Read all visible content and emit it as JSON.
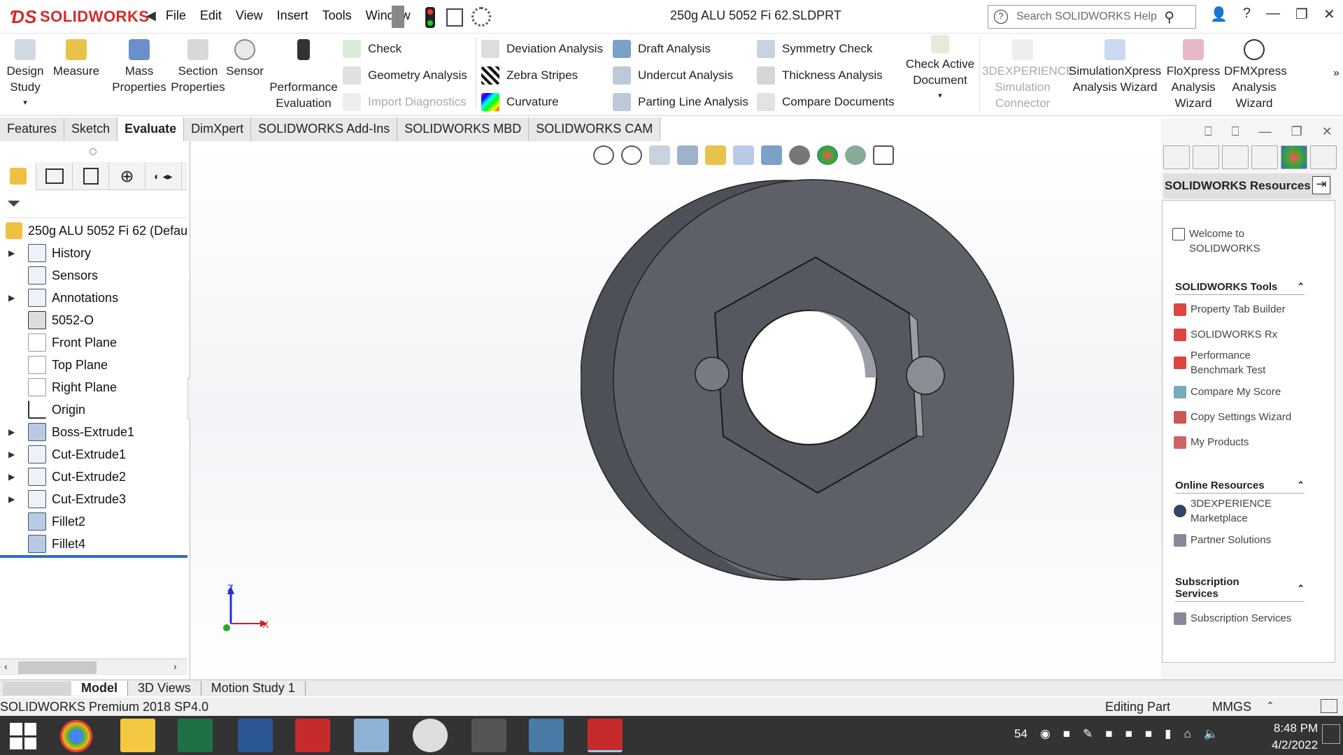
{
  "app": {
    "brand": "SOLIDWORKS",
    "menu": [
      "File",
      "Edit",
      "View",
      "Insert",
      "Tools",
      "Window"
    ],
    "document_title": "250g ALU 5052 Fi 62.SLDPRT",
    "search_placeholder": "Search SOLIDWORKS Help"
  },
  "ribbon": {
    "design_study": "Design Study",
    "measure": "Measure",
    "mass_properties": "Mass Properties",
    "section_properties": "Section Properties",
    "sensor": "Sensor",
    "performance_evaluation": "Performance Evaluation",
    "check": "Check",
    "geometry_analysis": "Geometry Analysis",
    "import_diagnostics": "Import Diagnostics",
    "deviation_analysis": "Deviation Analysis",
    "zebra_stripes": "Zebra Stripes",
    "curvature": "Curvature",
    "draft_analysis": "Draft Analysis",
    "undercut_analysis": "Undercut Analysis",
    "parting_line_analysis": "Parting Line Analysis",
    "symmetry_check": "Symmetry Check",
    "thickness_analysis": "Thickness Analysis",
    "compare_documents": "Compare Documents",
    "check_active_document": "Check Active Document",
    "simulation_connector": "3DEXPERIENCE Simulation Connector",
    "simulationxpress": "SimulationXpress Analysis Wizard",
    "floxpress": "FloXpress Analysis Wizard",
    "dfmxpress": "DFMXpress Analysis Wizard"
  },
  "command_tabs": [
    "Features",
    "Sketch",
    "Evaluate",
    "DimXpert",
    "SOLIDWORKS Add-Ins",
    "SOLIDWORKS MBD",
    "SOLIDWORKS CAM"
  ],
  "tree": {
    "root": "250g ALU 5052 Fi 62  (Defau",
    "items": [
      "History",
      "Sensors",
      "Annotations",
      "5052-O",
      "Front Plane",
      "Top Plane",
      "Right Plane",
      "Origin",
      "Boss-Extrude1",
      "Cut-Extrude1",
      "Cut-Extrude2",
      "Cut-Extrude3",
      "Fillet2",
      "Fillet4"
    ]
  },
  "triad": {
    "z": "Z",
    "x": "X"
  },
  "taskpane": {
    "header": "SOLIDWORKS Resources",
    "welcome": "Welcome to SOLIDWORKS",
    "tools_title": "SOLIDWORKS Tools",
    "tools": [
      "Property Tab Builder",
      "SOLIDWORKS Rx",
      "Performance Benchmark Test",
      "Compare My Score",
      "Copy Settings Wizard",
      "My Products"
    ],
    "online_title": "Online Resources",
    "online": [
      "3DEXPERIENCE Marketplace",
      "Partner Solutions"
    ],
    "subscription_title": "Subscription Services",
    "subscription": [
      "Subscription Services"
    ]
  },
  "bottom_tabs": [
    "Model",
    "3D Views",
    "Motion Study 1"
  ],
  "status": {
    "product": "SOLIDWORKS Premium 2018 SP4.0",
    "mode": "Editing Part",
    "units": "MMGS"
  },
  "taskbar": {
    "tray_count": "54",
    "time": "8:48 PM",
    "date": "4/2/2022"
  },
  "colors": {
    "brand_red": "#d52a2a",
    "part_gray": "#5c5f66",
    "selection_blue": "#2a6fbe"
  }
}
